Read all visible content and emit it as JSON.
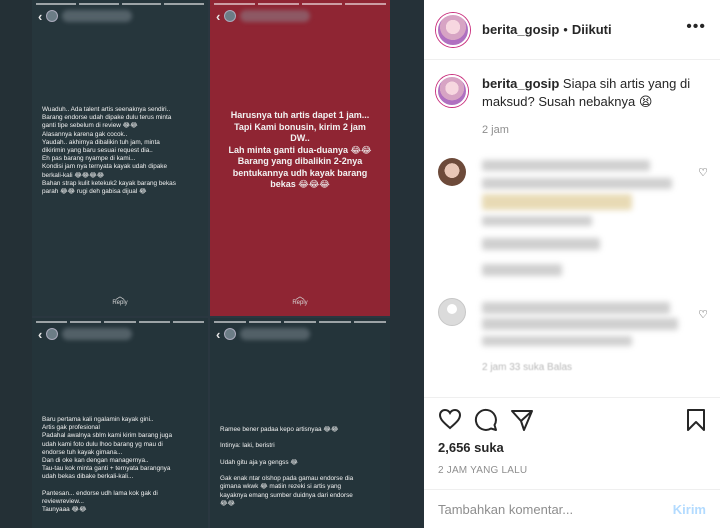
{
  "post": {
    "author": "berita_gosip",
    "follow_separator": "•",
    "follow_label": "Diikuti",
    "more_label": "•••"
  },
  "caption": {
    "author": "berita_gosip",
    "text": "Siapa sih artis yang di maksud? Susah nebaknya 😫",
    "time": "2 jam"
  },
  "comments": [
    {
      "heart": "♡",
      "meta": ""
    },
    {
      "heart": "♡",
      "meta": "2 jam   33 suka   Balas"
    }
  ],
  "likes": "2,656 suka",
  "posted_ago": "2 JAM YANG LALU",
  "comment_input": {
    "placeholder": "Tambahkan komentar...",
    "send_label": "Kirim"
  },
  "stories": {
    "back_glyph": "‹",
    "reply_label": "Reply",
    "reply_chevron": "︿",
    "top_left_text": "Wuaduh.. Ada talent artis seenaknya sendiri..\nBarang endorse udah dipake dulu terus minta\nganti tipe sebelum di review 😂😂\nAlasannya karena gak cocok..\nYaudah.. akhirnya dibalikin tuh jam, minta\ndikirimin yang baru sesuai request dia..\nEh pas barang nyampe di kami...\nKondisi jam nya ternyata kayak udah dipake\nberkali-kali 😂😂😂😂\nBahan strap kulit ketekuk2 kayak barang bekas\nparah 😂😂 rugi deh gabisa dijual 😂",
    "top_right_text": "Harusnya tuh artis dapet 1 jam...\nTapi Kami bonusin, kirim 2 jam\nDW..\nLah minta ganti dua-duanya 😂😂\nBarang yang dibalikin 2-2nya\nbentukannya udh kayak barang\nbekas 😂😂😂",
    "bottom_left_text": "Baru pertama kali ngalamin kayak gini..\nArtis gak profesional\nPadahal awalnya sblm kami kirim barang juga\nudah kami foto dulu lhoo barang yg mau di\nendorse tuh kayak gimana...\nDan di oke kan dengan managernya..\nTau-tau kok minta ganti + ternyata barangnya\nudah bekas dibake berkali-kali...\n\nPantesan... endorse udh lama kok gak di\nreviewreview...\nTaunyaaa 😂😂",
    "bottom_right_text": "Ramee bener padaa kepo artisnyaa 😂😂\n\nIntinya: laki, beristri\n\nUdah gitu aja ya gengss 😂\n\nGak enak ntar olshop pada gamau endorse dia\ngimana wkwk 😂 matiin rezeki si artis yang\nkayaknya emang sumber duidnya dari endorse\n😂😂"
  }
}
